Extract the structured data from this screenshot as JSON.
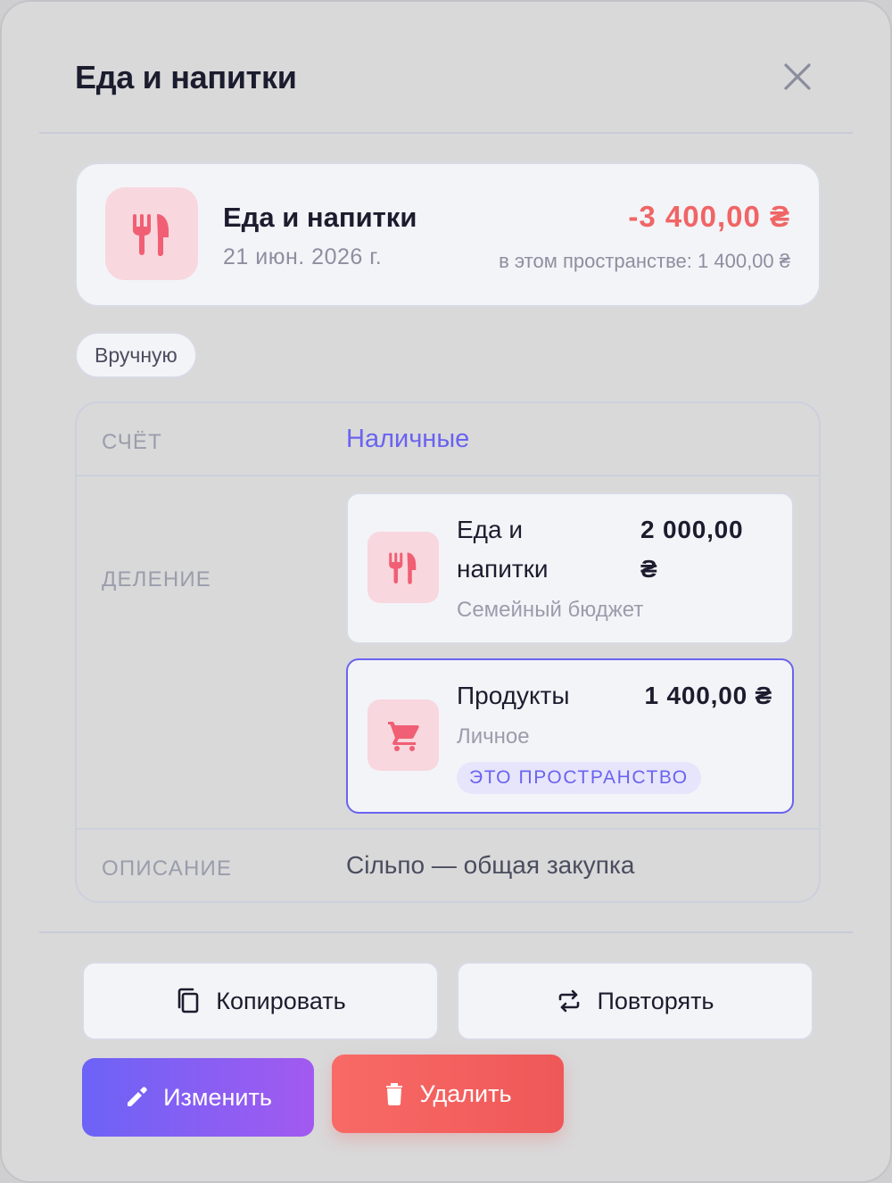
{
  "modal": {
    "title": "Еда и напитки"
  },
  "summary": {
    "category": "Еда и напитки",
    "date": "21 июн. 2026 г.",
    "amount": "-3 400,00 ₴",
    "space_share": "в этом пространстве: 1 400,00 ₴",
    "icon": "fork-knife-icon"
  },
  "source_chip": "Вручную",
  "details": {
    "account_label": "СЧЁТ",
    "account_value": "Наличные",
    "split_label": "ДЕЛЕНИЕ",
    "splits": [
      {
        "name_line1": "Еда и",
        "name_line2": "напитки",
        "amount_line1": "2 000,00",
        "amount_line2": "₴",
        "space": "Семейный бюджет",
        "icon": "fork-knife-icon"
      },
      {
        "name": "Продукты",
        "amount": "1 400,00 ₴",
        "space": "Личное",
        "badge": "ЭТО ПРОСТРАНСТВО",
        "icon": "cart-icon"
      }
    ],
    "description_label": "ОПИСАНИЕ",
    "description_value": "Сільпо — общая закупка"
  },
  "actions": {
    "copy": "Копировать",
    "repeat": "Повторять",
    "edit": "Изменить",
    "delete": "Удалить"
  },
  "colors": {
    "accent": "#6a63f0",
    "negative": "#f06565",
    "icon_tile": "#f8d7de"
  }
}
